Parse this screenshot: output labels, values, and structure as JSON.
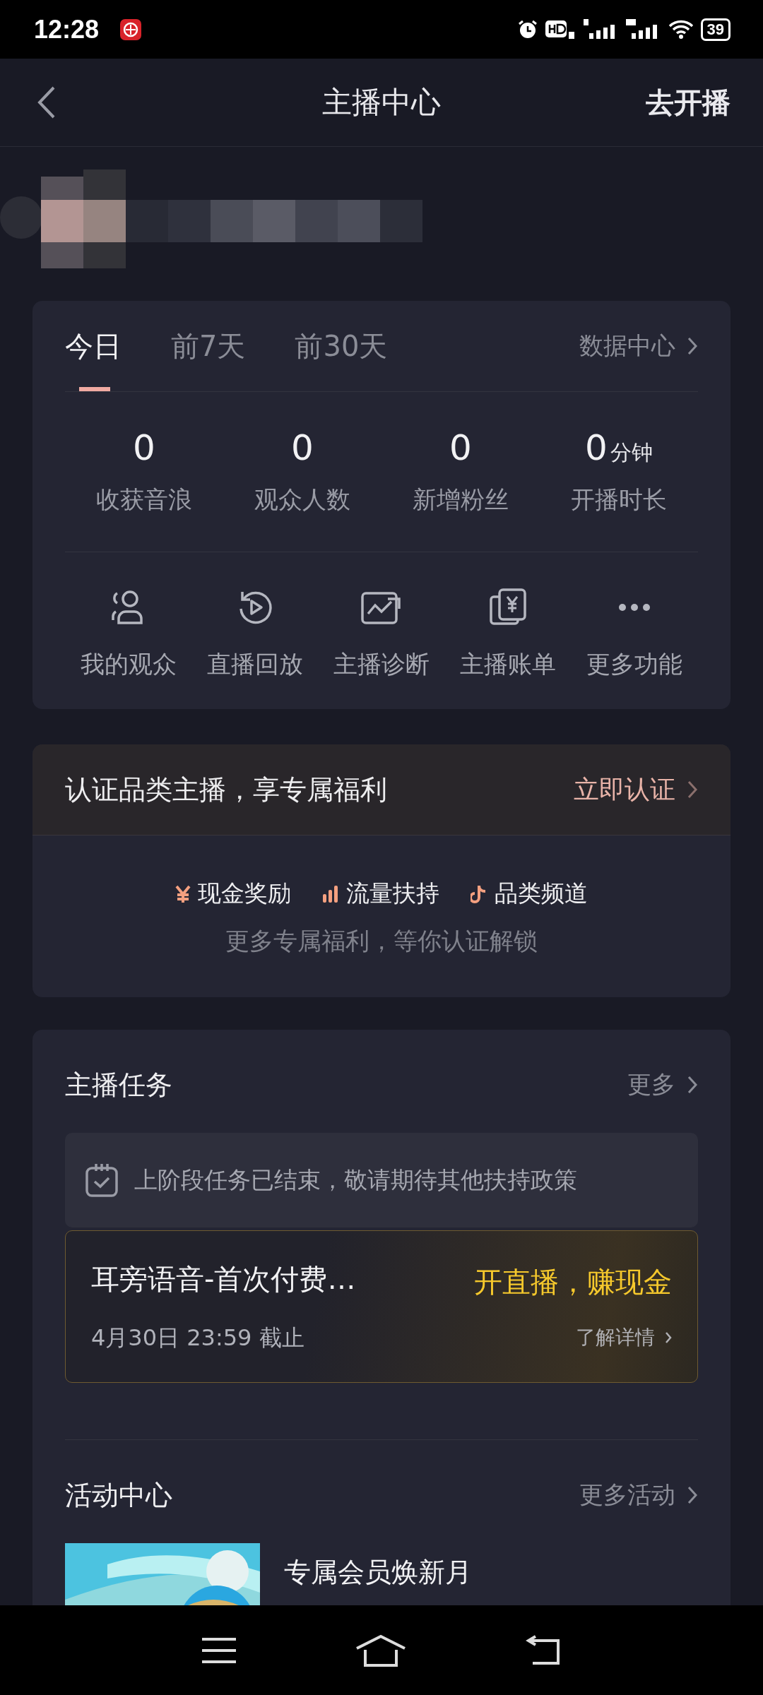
{
  "status_bar": {
    "time": "12:28",
    "battery": "39"
  },
  "header": {
    "title": "主播中心",
    "action": "去开播"
  },
  "stats_card": {
    "tabs": [
      {
        "label": "今日",
        "selected": true
      },
      {
        "label": "前7天",
        "selected": false
      },
      {
        "label": "前30天",
        "selected": false
      }
    ],
    "data_center": "数据中心",
    "stats": [
      {
        "value": "0",
        "label": "收获音浪"
      },
      {
        "value": "0",
        "label": "观众人数"
      },
      {
        "value": "0",
        "label": "新增粉丝"
      },
      {
        "value": "0",
        "unit": "分钟",
        "label": "开播时长"
      }
    ],
    "functions": [
      {
        "kind": "audience",
        "label": "我的观众"
      },
      {
        "kind": "replay",
        "label": "直播回放"
      },
      {
        "kind": "diagnosis",
        "label": "主播诊断"
      },
      {
        "kind": "bill",
        "label": "主播账单"
      },
      {
        "kind": "more",
        "label": "更多功能"
      }
    ]
  },
  "certification": {
    "title": "认证品类主播，享专属福利",
    "action": "立即认证",
    "benefits": [
      {
        "kind": "cash",
        "label": "现金奖励"
      },
      {
        "kind": "traffic",
        "label": "流量扶持"
      },
      {
        "kind": "channel",
        "label": "品类频道"
      }
    ],
    "note": "更多专属福利，等你认证解锁"
  },
  "tasks": {
    "title": "主播任务",
    "more": "更多",
    "notice": "上阶段任务已结束，敬请期待其他扶持政策",
    "task": {
      "name": "耳旁语音-首次付费…",
      "deadline": "4月30日 23:59 截止",
      "promo": "开直播，赚现金",
      "details": "了解详情"
    }
  },
  "activities": {
    "title": "活动中心",
    "more": "更多活动",
    "items": [
      {
        "kind": "picture",
        "title": "专属会员焕新月"
      }
    ]
  }
}
